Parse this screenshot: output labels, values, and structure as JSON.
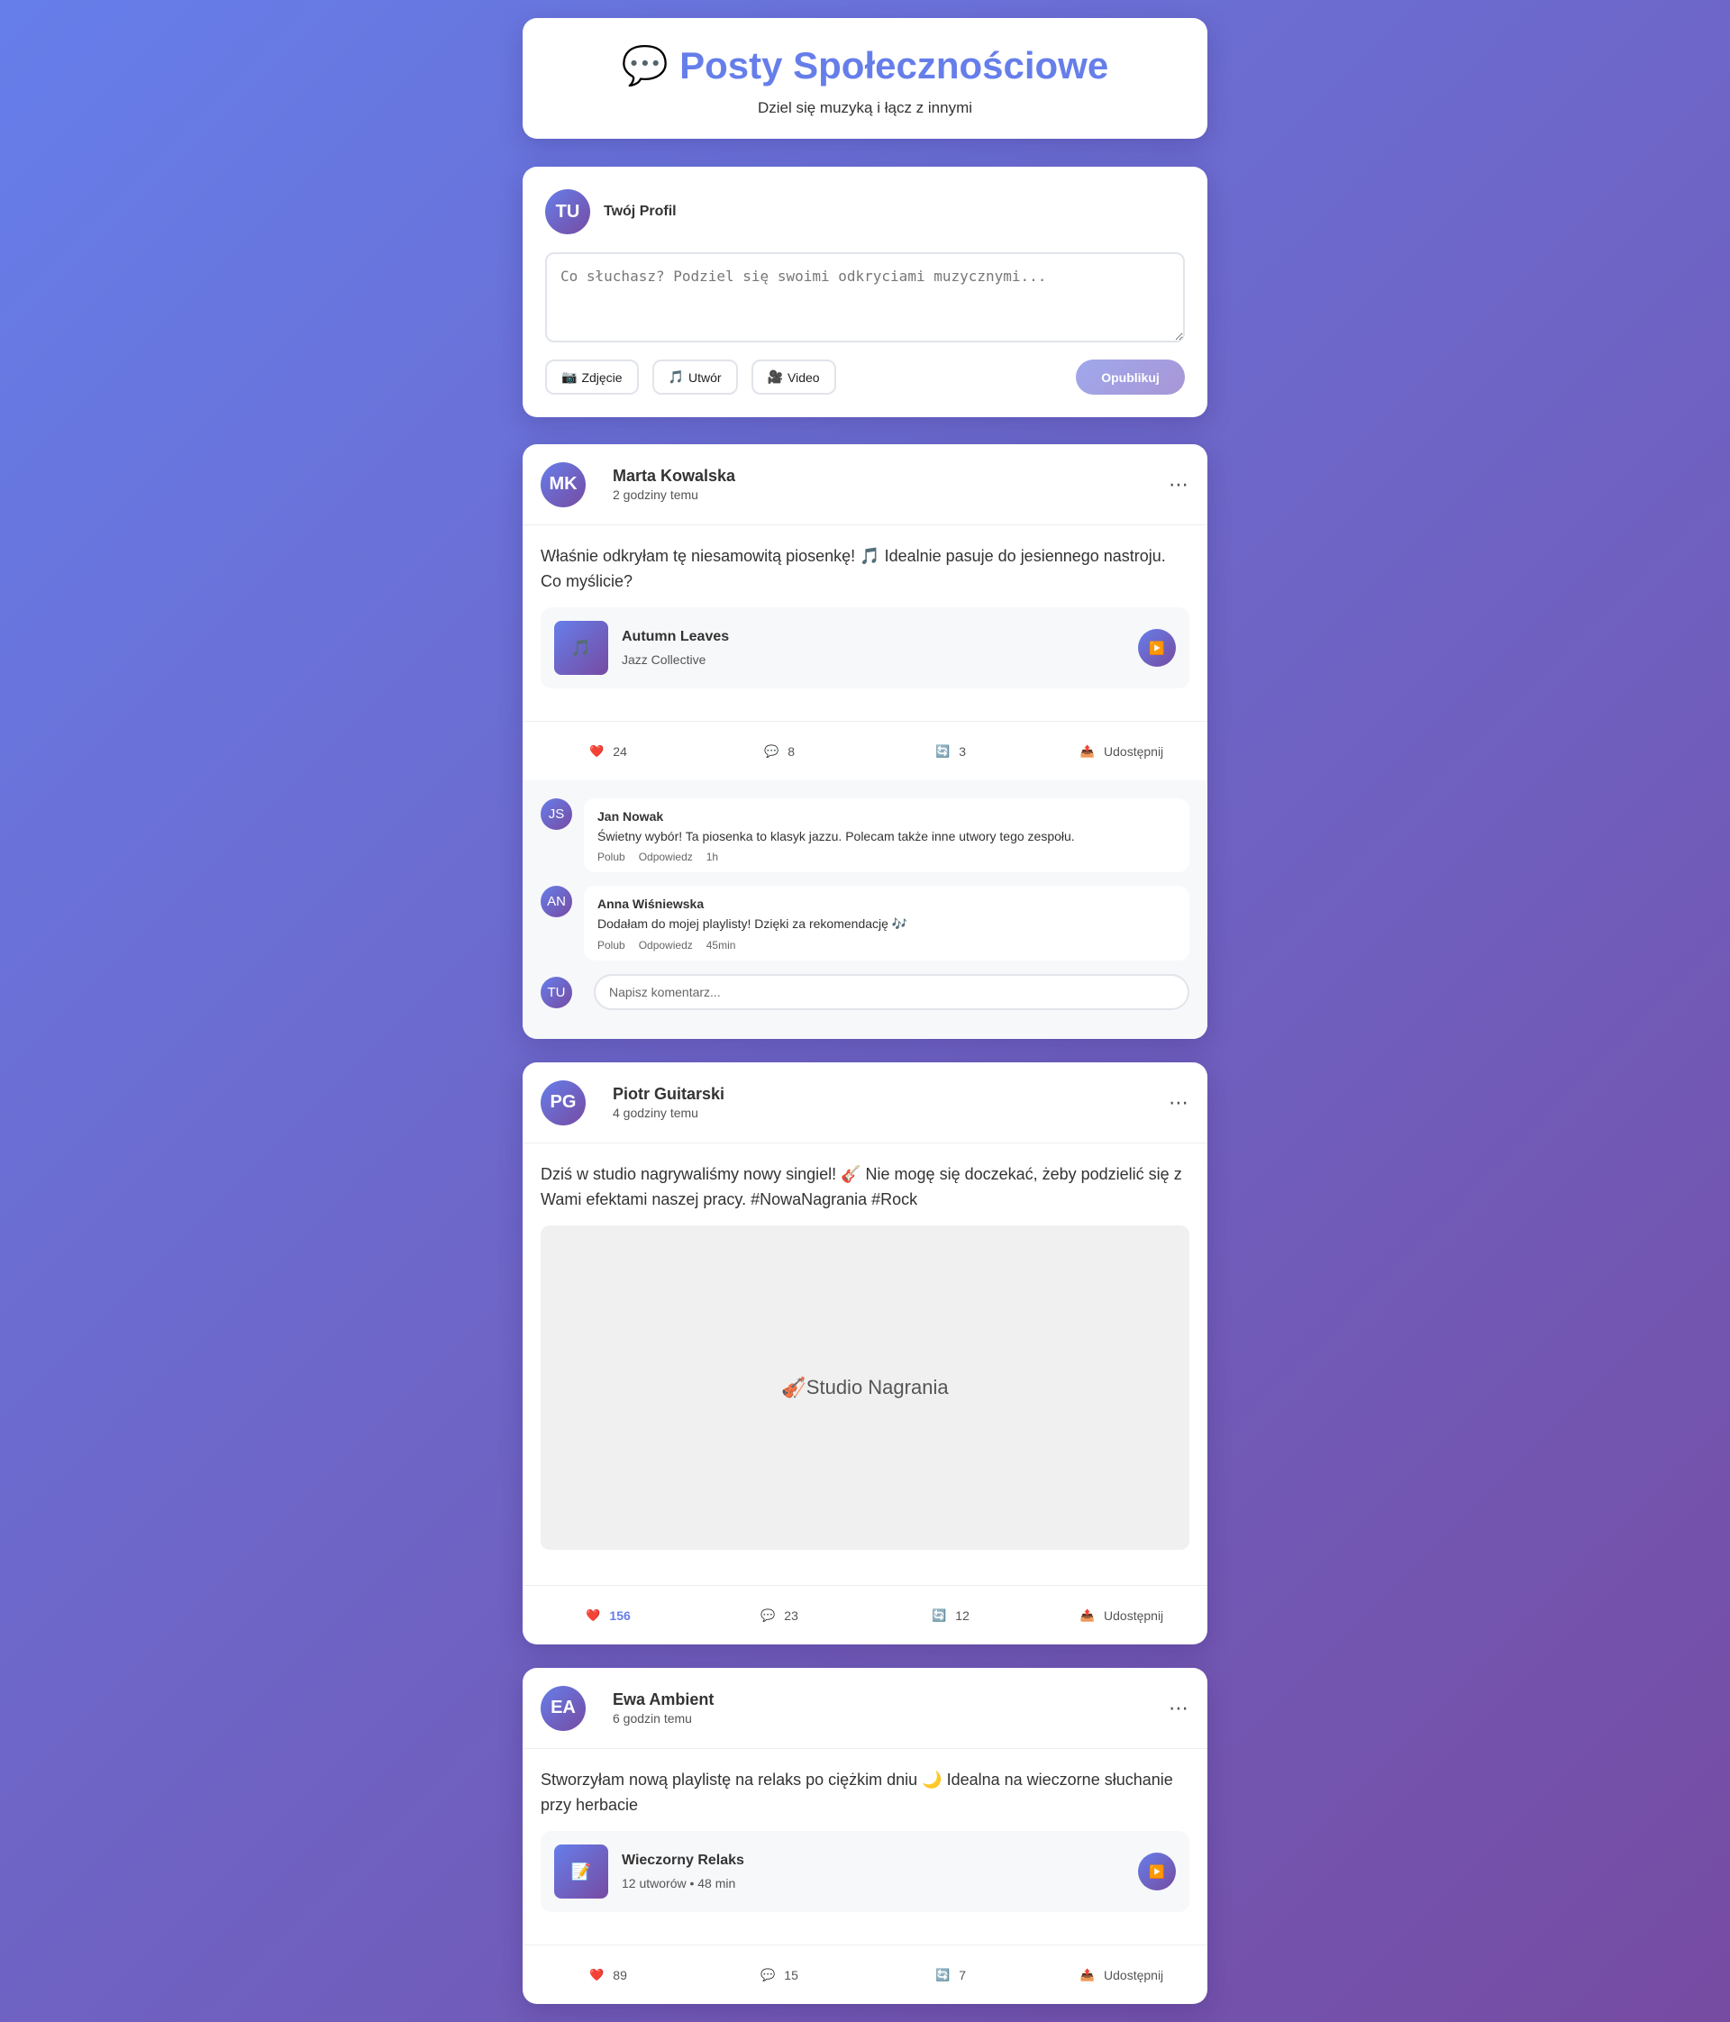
{
  "header": {
    "icon": "speech-bubble-icon",
    "emoji": "💬",
    "title": "Posty Społecznościowe",
    "subtitle": "Dziel się muzyką i łącz z innymi"
  },
  "composer": {
    "avatar_initials": "TU",
    "profile_name": "Twój Profil",
    "placeholder": "Co słuchasz? Podziel się swoimi odkryciami muzycznymi...",
    "buttons": [
      {
        "emoji": "📷",
        "label": "Zdjęcie"
      },
      {
        "emoji": "🎵",
        "label": "Utwór"
      },
      {
        "emoji": "🎥",
        "label": "Video"
      }
    ],
    "publish_label": "Opublikuj"
  },
  "posts": [
    {
      "avatar": "MK",
      "author": "Marta Kowalska",
      "time": "2 godziny temu",
      "text": "Właśnie odkryłam tę niesamowitą piosenkę! 🎵 Idealnie pasuje do jesiennego nastroju. Co myślicie?",
      "music": {
        "cover_emoji": "🎵",
        "title": "Autumn Leaves",
        "subtitle": "Jazz Collective",
        "play": "▶️"
      },
      "likes": "24",
      "comments_count": "8",
      "shares": "3",
      "share_label": "Udostępnij",
      "comments": [
        {
          "avatar": "JS",
          "name": "Jan Nowak",
          "text": "Świetny wybór! Ta piosenka to klasyk jazzu. Polecam także inne utwory tego zespołu.",
          "like": "Polub",
          "reply": "Odpowiedz",
          "time": "1h"
        },
        {
          "avatar": "AN",
          "name": "Anna Wiśniewska",
          "text": "Dodałam do mojej playlisty! Dzięki za rekomendację 🎶",
          "like": "Polub",
          "reply": "Odpowiedz",
          "time": "45min"
        }
      ],
      "comment_avatar": "TU",
      "comment_placeholder": "Napisz komentarz..."
    },
    {
      "avatar": "PG",
      "author": "Piotr Guitarski",
      "time": "4 godziny temu",
      "text": "Dziś w studio nagrywaliśmy nowy singiel! 🎸 Nie mogę się doczekać, żeby podzielić się z Wami efektami naszej pracy. #NowaNagrania #Rock",
      "image_label": "🎻Studio Nagrania",
      "likes": "156",
      "comments_count": "23",
      "shares": "12",
      "share_label": "Udostępnij"
    },
    {
      "avatar": "EA",
      "author": "Ewa Ambient",
      "time": "6 godzin temu",
      "text": "Stworzyłam nową playlistę na relaks po ciężkim dniu 🌙 Idealna na wieczorne słuchanie przy herbacie",
      "music": {
        "cover_emoji": "📝",
        "title": "Wieczorny Relaks",
        "subtitle": "12 utworów • 48 min",
        "play": "▶️"
      },
      "likes": "89",
      "comments_count": "15",
      "shares": "7",
      "share_label": "Udostępnij"
    }
  ],
  "icons": {
    "like": "❤️",
    "comment": "💬",
    "repost": "🔄",
    "share": "📤",
    "more": "⋯"
  },
  "colors": {
    "accent": "#667eea",
    "gradient_start": "#667eea",
    "gradient_end": "#764ba2",
    "like": "#e53935"
  }
}
